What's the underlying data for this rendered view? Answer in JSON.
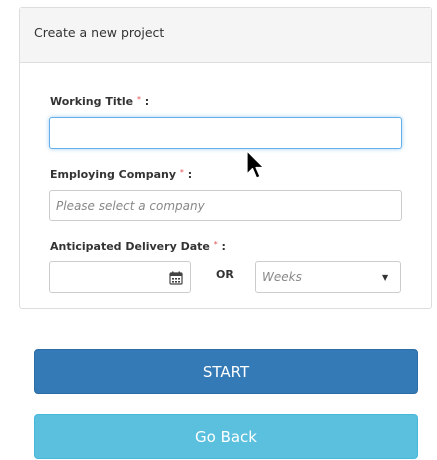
{
  "panel": {
    "title": "Create a new project"
  },
  "form": {
    "working_title": {
      "label": "Working Title",
      "required_marker": "*",
      "suffix": ":",
      "value": ""
    },
    "employing_company": {
      "label": "Employing Company",
      "required_marker": "*",
      "suffix": ":",
      "placeholder": "Please select a company"
    },
    "delivery_date": {
      "label": "Anticipated Delivery Date",
      "required_marker": "*",
      "suffix": ":",
      "date_value": "",
      "or_text": "OR",
      "weeks_selected": "Weeks"
    }
  },
  "buttons": {
    "start_label": "START",
    "back_label": "Go Back"
  },
  "colors": {
    "primary": "#337ab7",
    "info": "#5bc0de",
    "required": "#e05555",
    "focus": "#66afe9"
  },
  "icons": {
    "calendar": "calendar-icon",
    "dropdown": "caret-down-icon",
    "cursor": "mouse-pointer-icon"
  }
}
